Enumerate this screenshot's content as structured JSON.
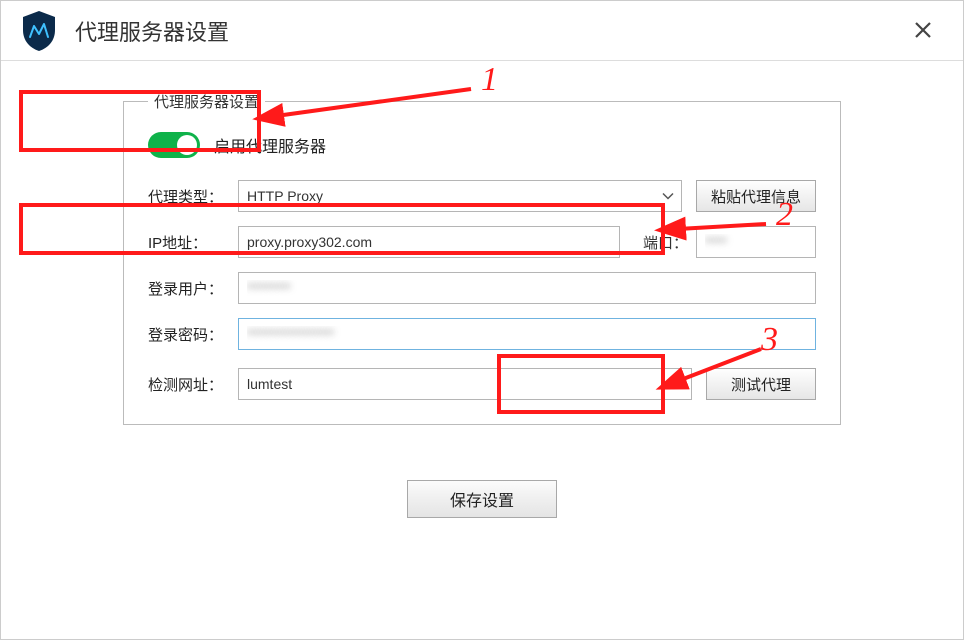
{
  "header": {
    "title": "代理服务器设置"
  },
  "fieldset": {
    "legend": "代理服务器设置",
    "enable_proxy_label": "启用代理服务器",
    "proxy_type_label": "代理类型：",
    "proxy_type_value": "HTTP Proxy",
    "paste_info_label": "粘贴代理信息",
    "ip_label": "IP地址：",
    "ip_value": "proxy.proxy302.com",
    "port_label": "端口：",
    "port_value": "****",
    "user_label": "登录用户：",
    "user_value": "********",
    "pass_label": "登录密码：",
    "pass_value": "****************",
    "test_url_label": "检测网址：",
    "test_url_value": "lumtest",
    "test_proxy_label": "测试代理"
  },
  "buttons": {
    "save": "保存设置"
  },
  "annotations": {
    "n1": "1",
    "n2": "2",
    "n3": "3"
  }
}
